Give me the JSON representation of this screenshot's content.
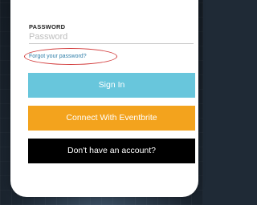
{
  "password": {
    "label": "PASSWORD",
    "placeholder": "Password",
    "value": ""
  },
  "forgot_link": "Forgot your password?",
  "buttons": {
    "sign_in": "Sign In",
    "eventbrite": "Connect With Eventbrite",
    "no_account": "Don't have an account?"
  },
  "colors": {
    "sign_in_bg": "#68c6dc",
    "eventbrite_bg": "#f3a31d",
    "no_account_bg": "#000000",
    "link": "#2f7ea8",
    "highlight_ring": "#d23a3a",
    "backdrop": "#1f2a36"
  }
}
